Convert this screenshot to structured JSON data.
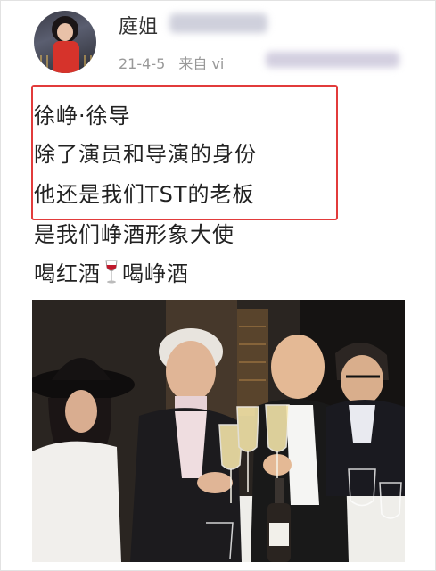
{
  "post": {
    "author": "庭姐",
    "date": "21-4-5",
    "source_prefix": "来自 vi"
  },
  "content": {
    "lines": [
      "徐峥·徐导",
      "除了演员和导演的身份",
      "他还是我们TST的老板",
      "是我们峥酒形象大使"
    ],
    "last_line_part1": "喝红酒",
    "last_line_part2": "喝峥酒",
    "emoji": "wine-glass-icon"
  },
  "colors": {
    "highlight_border": "#e23b3b",
    "meta_text": "#999999"
  },
  "photo": {
    "description_icon": "group-photo"
  }
}
